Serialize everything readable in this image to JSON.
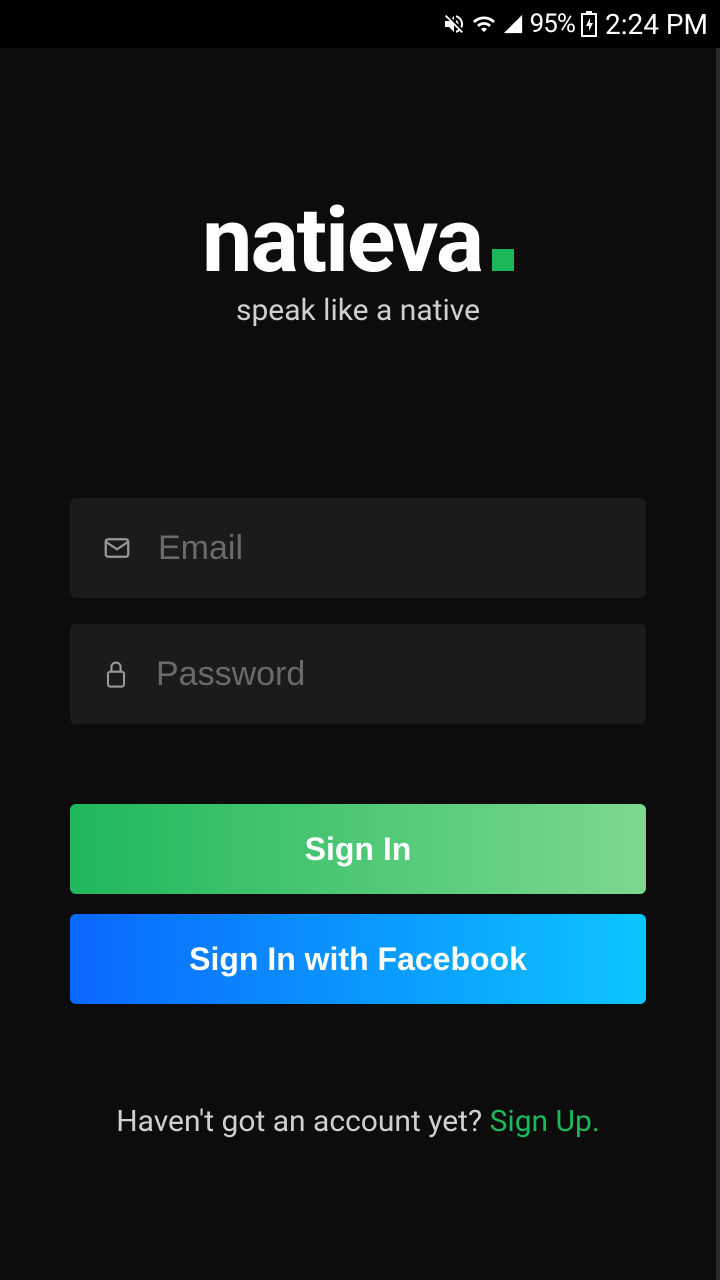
{
  "status_bar": {
    "battery_percent": "95%",
    "time": "2:24 PM"
  },
  "logo": {
    "text": "natieva",
    "tagline": "speak like a native"
  },
  "form": {
    "email_placeholder": "Email",
    "password_placeholder": "Password"
  },
  "buttons": {
    "signin": "Sign In",
    "facebook": "Sign In with Facebook"
  },
  "signup": {
    "prompt": "Haven't got an account yet? ",
    "link": "Sign Up."
  }
}
